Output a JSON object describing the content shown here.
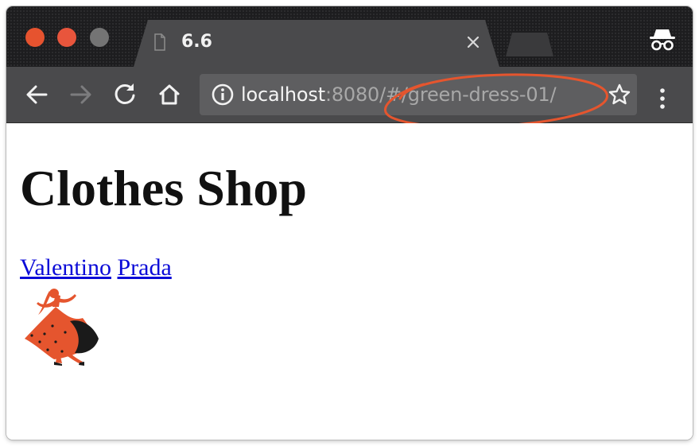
{
  "window": {
    "tab_title": "6.6",
    "url_host": "localhost",
    "url_rest": ":8080/#/green-dress-01/"
  },
  "colors": {
    "close_light": "#e6532f",
    "minimize_light": "#e8553c",
    "maximize_light": "#747474",
    "annotation": "#e5552e",
    "link": "#0b0bd8",
    "dancer": "#e5552e"
  },
  "icons": {
    "back": "arrow-left-icon",
    "forward": "arrow-right-icon",
    "reload": "reload-icon",
    "home": "home-icon",
    "info": "info-icon",
    "bookmark": "star-icon",
    "menu": "kebab-menu-icon",
    "incognito": "incognito-icon"
  },
  "page": {
    "heading": "Clothes Shop",
    "links": [
      {
        "label": "Valentino"
      },
      {
        "label": "Prada"
      }
    ],
    "image": "dancer-in-red-dress"
  }
}
